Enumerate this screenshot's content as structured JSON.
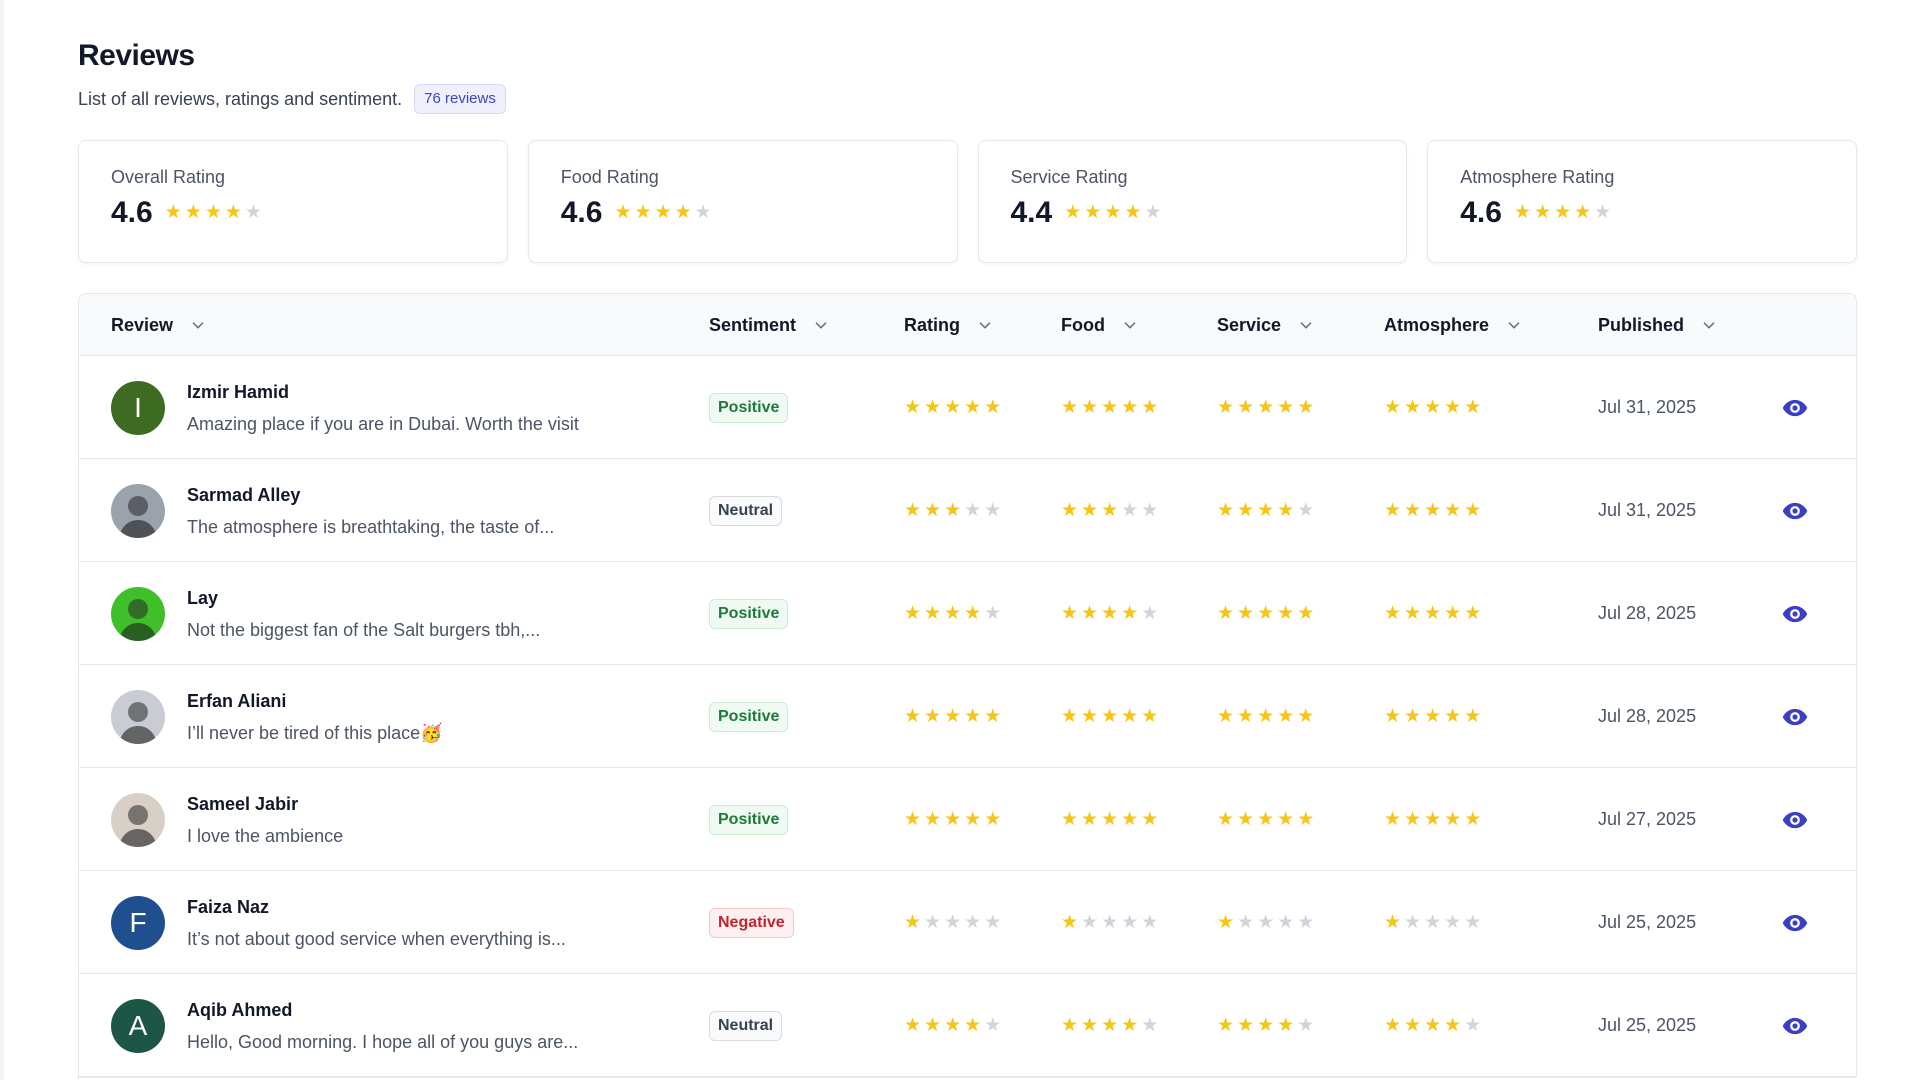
{
  "page": {
    "title": "Reviews",
    "subtitle": "List of all reviews, ratings and sentiment.",
    "count_badge": "76 reviews"
  },
  "summary_cards": [
    {
      "label": "Overall Rating",
      "value": "4.6",
      "stars": 4
    },
    {
      "label": "Food Rating",
      "value": "4.6",
      "stars": 4
    },
    {
      "label": "Service Rating",
      "value": "4.4",
      "stars": 4
    },
    {
      "label": "Atmosphere Rating",
      "value": "4.6",
      "stars": 4
    }
  ],
  "table": {
    "columns": {
      "review": "Review",
      "sentiment": "Sentiment",
      "rating": "Rating",
      "food": "Food",
      "service": "Service",
      "atmosphere": "Atmosphere",
      "published": "Published"
    },
    "rows": [
      {
        "name": "Izmir Hamid",
        "comment": "Amazing place if you are in Dubai. Worth the visit",
        "avatar": {
          "type": "letter",
          "letter": "I",
          "color": "#3d6b22"
        },
        "sentiment": "Positive",
        "sentiment_key": "positive",
        "rating": 5,
        "food": 5,
        "service": 5,
        "atmosphere": 5,
        "published": "Jul 31, 2025"
      },
      {
        "name": "Sarmad Alley",
        "comment": "The atmosphere is breathtaking, the taste of...",
        "avatar": {
          "type": "photo",
          "color": "#9aa3ab"
        },
        "sentiment": "Neutral",
        "sentiment_key": "neutral",
        "rating": 3,
        "food": 3,
        "service": 4,
        "atmosphere": 5,
        "published": "Jul 31, 2025"
      },
      {
        "name": "Lay",
        "comment": "Not the biggest fan of the Salt burgers tbh,...",
        "avatar": {
          "type": "photo",
          "color": "#3fbf2a"
        },
        "sentiment": "Positive",
        "sentiment_key": "positive",
        "rating": 4,
        "food": 4,
        "service": 5,
        "atmosphere": 5,
        "published": "Jul 28, 2025"
      },
      {
        "name": "Erfan Aliani",
        "comment": "I’ll never be tired of this place🥳",
        "avatar": {
          "type": "photo",
          "color": "#c9ccd2"
        },
        "sentiment": "Positive",
        "sentiment_key": "positive",
        "rating": 5,
        "food": 5,
        "service": 5,
        "atmosphere": 5,
        "published": "Jul 28, 2025"
      },
      {
        "name": "Sameel Jabir",
        "comment": "I love the ambience",
        "avatar": {
          "type": "photo",
          "color": "#d8cfc6"
        },
        "sentiment": "Positive",
        "sentiment_key": "positive",
        "rating": 5,
        "food": 5,
        "service": 5,
        "atmosphere": 5,
        "published": "Jul 27, 2025"
      },
      {
        "name": "Faiza Naz",
        "comment": "It’s not about good service when everything is...",
        "avatar": {
          "type": "letter",
          "letter": "F",
          "color": "#1f4f8f"
        },
        "sentiment": "Negative",
        "sentiment_key": "negative",
        "rating": 1,
        "food": 1,
        "service": 1,
        "atmosphere": 1,
        "published": "Jul 25, 2025"
      },
      {
        "name": "Aqib Ahmed",
        "comment": "Hello, Good morning. I hope all of you guys are...",
        "avatar": {
          "type": "letter",
          "letter": "A",
          "color": "#1d5646"
        },
        "sentiment": "Neutral",
        "sentiment_key": "neutral",
        "rating": 4,
        "food": 4,
        "service": 4,
        "atmosphere": 4,
        "published": "Jul 25, 2025"
      }
    ]
  },
  "icons": {
    "star": "star-icon",
    "sort": "chevron-down-icon",
    "view": "eye-icon"
  },
  "colors": {
    "star_filled": "#f5c518",
    "star_empty": "#d1d5db",
    "accent": "#3b3fc4"
  }
}
